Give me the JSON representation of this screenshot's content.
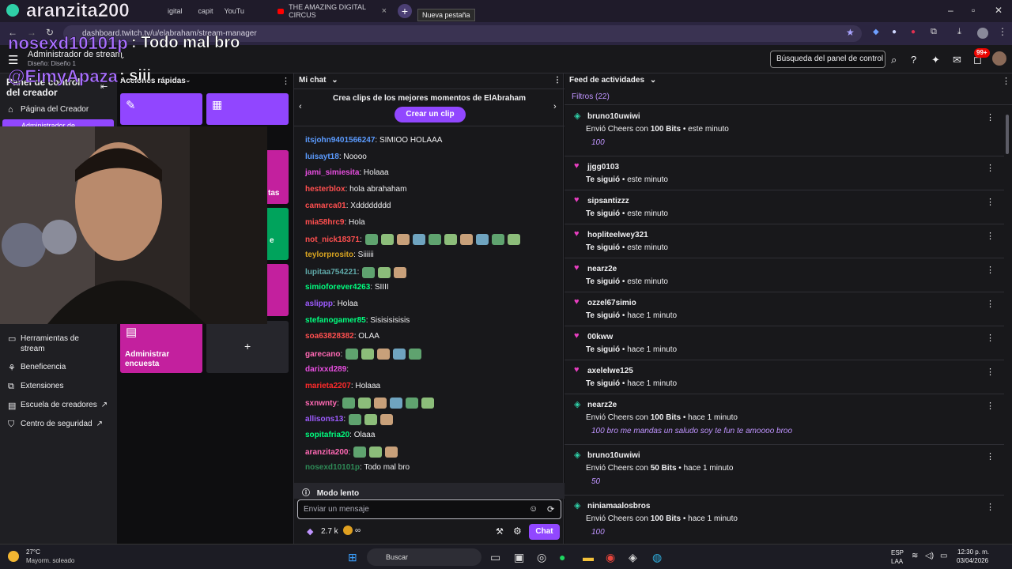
{
  "browser": {
    "tabs": [
      {
        "label": "aranzita200",
        "kind": "overlay"
      },
      {
        "label": "THE AMAZING DIGITAL CIRCUS"
      }
    ],
    "tooltip": "Nueva pestaña",
    "url": "dashboard.twitch.tv/u/elabraham/stream-manager",
    "partial_tab_fragments": [
      "igital",
      "capit",
      "YouTu"
    ]
  },
  "overlay_chat": [
    {
      "user": "nosexd10101p",
      "text": ": Todo mal bro"
    },
    {
      "user": "@EimyApaza",
      "text": ": siii"
    }
  ],
  "header": {
    "title": "Administrador de stream",
    "subtitle": "Diseño: Diseño 1",
    "search_placeholder": "Búsqueda del panel de control",
    "notif_badge": "99+"
  },
  "sidebar": {
    "title_partial": "Panel de control del creador",
    "items": [
      {
        "icon": "home-icon",
        "label": "Página del Creador"
      },
      {
        "icon": "tools-icon",
        "label": "Herramientas de stream"
      },
      {
        "icon": "charity-icon",
        "label": "Beneficencia"
      },
      {
        "icon": "extensions-icon",
        "label": "Extensiones"
      },
      {
        "icon": "school-icon",
        "label": "Escuela de creadores"
      },
      {
        "icon": "shield-icon",
        "label": "Centro de seguridad"
      }
    ],
    "active_partial": "Administrador de"
  },
  "quick_actions": {
    "title": "Acciones rápidas",
    "partial_label": "tas",
    "partial_label2": "e",
    "poll": "Administrar encuesta",
    "add": "+"
  },
  "chat": {
    "title": "Mi chat",
    "clip_text": "Crea clips de los mejores momentos de ElAbraham",
    "clip_button": "Crear un clip",
    "messages": [
      {
        "user": "itsjohn9401566247",
        "color": "#5b9bff",
        "text": ": SIMIOO HOLAAA",
        "emotes": 0
      },
      {
        "user": "luisayt18",
        "color": "#5b9bff",
        "text": ": Noooo",
        "emotes": 0
      },
      {
        "user": "jami_simiesita",
        "color": "#e84ee0",
        "text": ": Holaaa",
        "emotes": 0
      },
      {
        "user": "hesterblox",
        "color": "#ff4f4f",
        "text": ": hola abrahaham",
        "emotes": 0
      },
      {
        "user": "camarca01",
        "color": "#ff4f4f",
        "text": ": Xdddddddd",
        "emotes": 0
      },
      {
        "user": "mia58hrc9",
        "color": "#ff4f4f",
        "text": ": Hola",
        "emotes": 0
      },
      {
        "user": "not_nick18371",
        "color": "#ff4f4f",
        "text": ":",
        "emotes": 10
      },
      {
        "user": "teylorprosito",
        "color": "#daa520",
        "text": ": Siiiiii",
        "emotes": 0
      },
      {
        "user": "lupitaa754221",
        "color": "#5fa8a8",
        "text": ":",
        "emotes": 3
      },
      {
        "user": "simioforever4263",
        "color": "#00ff7f",
        "text": ": SIIII",
        "emotes": 0
      },
      {
        "user": "aslippp",
        "color": "#9d5bff",
        "text": ": Holaa",
        "emotes": 0
      },
      {
        "user": "stefanogamer85",
        "color": "#00ff7f",
        "text": ": Sisisisisisis",
        "emotes": 0
      },
      {
        "user": "soa63828382",
        "color": "#ff4f4f",
        "text": ": OLAA",
        "emotes": 0
      },
      {
        "user": "garecano",
        "color": "#ff69b4",
        "text": ":",
        "emotes": 5
      },
      {
        "user": "darixxd289",
        "color": "#e84ee0",
        "text": ":",
        "emotes": 0
      },
      {
        "user": "marieta2207",
        "color": "#ff2a2a",
        "text": ": Holaaa",
        "emotes": 0
      },
      {
        "user": "sxnwnty",
        "color": "#ff69b4",
        "text": ":",
        "emotes": 6
      },
      {
        "user": "allisons13",
        "color": "#9d5bff",
        "text": ":",
        "emotes": 3
      },
      {
        "user": "sopitafria20",
        "color": "#00ff7f",
        "text": ": Olaaa",
        "emotes": 0
      },
      {
        "user": "aranzita200",
        "color": "#ff69b4",
        "text": ":",
        "emotes": 3
      },
      {
        "user": "nosexd10101p",
        "color": "#2e8b57",
        "text": ": Todo mal bro",
        "emotes": 0
      }
    ],
    "slow_mode": "Modo lento",
    "input_placeholder": "Enviar un mensaje",
    "bits": "2.7 k",
    "infinity": "∞",
    "send": "Chat"
  },
  "feed": {
    "title": "Feed de actividades",
    "filter": "Filtros (22)",
    "events": [
      {
        "type": "cheer",
        "user": "bruno10uwiwi",
        "pre": "Envió Cheers con ",
        "bold": "100 Bits",
        "time": " • este minuto",
        "extra": "100"
      },
      {
        "type": "follow",
        "user": "jjgg0103",
        "pre": "Te siguió",
        "bold": "",
        "time": " • este minuto",
        "extra": ""
      },
      {
        "type": "follow",
        "user": "sipsantizzz",
        "pre": "Te siguió",
        "bold": "",
        "time": " • este minuto",
        "extra": ""
      },
      {
        "type": "follow",
        "user": "hopliteelwey321",
        "pre": "Te siguió",
        "bold": "",
        "time": " • este minuto",
        "extra": ""
      },
      {
        "type": "follow",
        "user": "nearz2e",
        "pre": "Te siguió",
        "bold": "",
        "time": " • este minuto",
        "extra": ""
      },
      {
        "type": "follow",
        "user": "ozzel67simio",
        "pre": "Te siguió",
        "bold": "",
        "time": " • hace 1 minuto",
        "extra": ""
      },
      {
        "type": "follow",
        "user": "00kww",
        "pre": "Te siguió",
        "bold": "",
        "time": " • hace 1 minuto",
        "extra": ""
      },
      {
        "type": "follow",
        "user": "axelelwe125",
        "pre": "Te siguió",
        "bold": "",
        "time": " • hace 1 minuto",
        "extra": ""
      },
      {
        "type": "cheer",
        "user": "nearz2e",
        "pre": "Envió Cheers con ",
        "bold": "100 Bits",
        "time": " • hace 1 minuto",
        "extra": "100 bro me mandas un saludo soy te fun te amoooo broo"
      },
      {
        "type": "cheer",
        "user": "bruno10uwiwi",
        "pre": "Envió Cheers con ",
        "bold": "50 Bits",
        "time": " • hace 1 minuto",
        "extra": "50"
      },
      {
        "type": "cheer",
        "user": "niniamaalosbros",
        "pre": "Envió Cheers con ",
        "bold": "100 Bits",
        "time": " • hace 1 minuto",
        "extra": "100"
      }
    ]
  },
  "taskbar": {
    "weather_temp": "27°C",
    "weather_desc": "Mayorm. soleado",
    "search": "Buscar",
    "lang": "ESP",
    "region": "LAA",
    "time": "12:30 p. m.",
    "date": "03/04/2026"
  },
  "colors": {
    "purple": "#9147ff",
    "feed_accent": "#bf94ff",
    "quick_purple": "#9146ff",
    "quick_magenta": "#c3209e",
    "quick_green": "#00a35c"
  }
}
